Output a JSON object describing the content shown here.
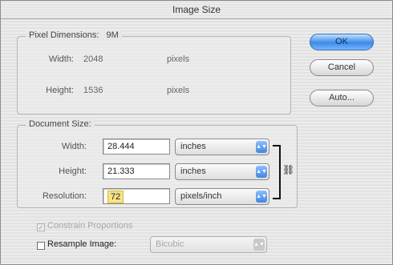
{
  "window": {
    "title": "Image Size"
  },
  "pixel_dimensions": {
    "label": "Pixel Dimensions:",
    "size": "9M",
    "width_label": "Width:",
    "width_value": "2048",
    "width_unit": "pixels",
    "height_label": "Height:",
    "height_value": "1536",
    "height_unit": "pixels"
  },
  "document_size": {
    "label": "Document Size:",
    "width_label": "Width:",
    "width_value": "28.444",
    "width_unit": "inches",
    "height_label": "Height:",
    "height_value": "21.333",
    "height_unit": "inches",
    "resolution_label": "Resolution:",
    "resolution_value": "72",
    "resolution_unit": "pixels/inch"
  },
  "buttons": {
    "ok": "OK",
    "cancel": "Cancel",
    "auto": "Auto..."
  },
  "options": {
    "constrain_label": "Constrain Proportions",
    "constrain_checked": true,
    "resample_label": "Resample Image:",
    "resample_checked": false,
    "resample_method": "Bicubic"
  },
  "colors": {
    "accent": "#3d8ae6",
    "highlight": "#f6e28a"
  }
}
